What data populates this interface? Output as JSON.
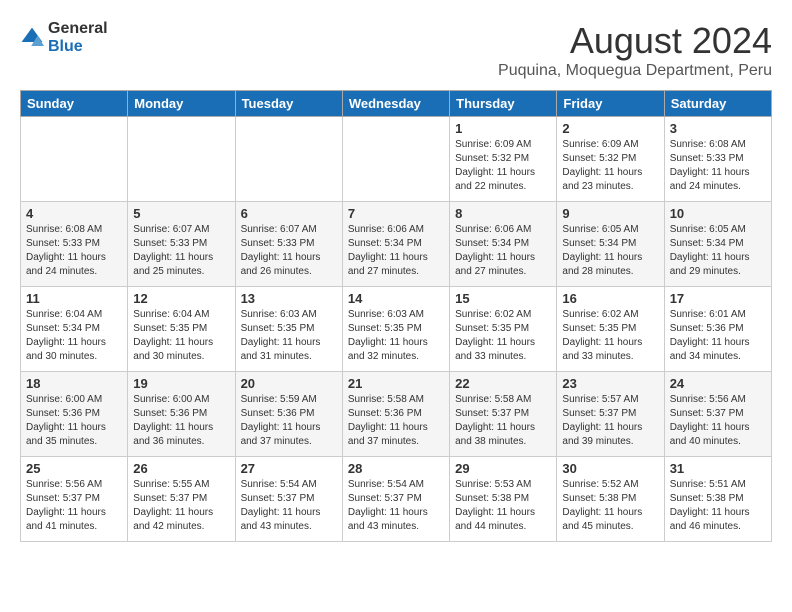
{
  "header": {
    "logo_general": "General",
    "logo_blue": "Blue",
    "month": "August 2024",
    "location": "Puquina, Moquegua Department, Peru"
  },
  "weekdays": [
    "Sunday",
    "Monday",
    "Tuesday",
    "Wednesday",
    "Thursday",
    "Friday",
    "Saturday"
  ],
  "weeks": [
    [
      {
        "day": "",
        "info": ""
      },
      {
        "day": "",
        "info": ""
      },
      {
        "day": "",
        "info": ""
      },
      {
        "day": "",
        "info": ""
      },
      {
        "day": "1",
        "info": "Sunrise: 6:09 AM\nSunset: 5:32 PM\nDaylight: 11 hours\nand 22 minutes."
      },
      {
        "day": "2",
        "info": "Sunrise: 6:09 AM\nSunset: 5:32 PM\nDaylight: 11 hours\nand 23 minutes."
      },
      {
        "day": "3",
        "info": "Sunrise: 6:08 AM\nSunset: 5:33 PM\nDaylight: 11 hours\nand 24 minutes."
      }
    ],
    [
      {
        "day": "4",
        "info": "Sunrise: 6:08 AM\nSunset: 5:33 PM\nDaylight: 11 hours\nand 24 minutes."
      },
      {
        "day": "5",
        "info": "Sunrise: 6:07 AM\nSunset: 5:33 PM\nDaylight: 11 hours\nand 25 minutes."
      },
      {
        "day": "6",
        "info": "Sunrise: 6:07 AM\nSunset: 5:33 PM\nDaylight: 11 hours\nand 26 minutes."
      },
      {
        "day": "7",
        "info": "Sunrise: 6:06 AM\nSunset: 5:34 PM\nDaylight: 11 hours\nand 27 minutes."
      },
      {
        "day": "8",
        "info": "Sunrise: 6:06 AM\nSunset: 5:34 PM\nDaylight: 11 hours\nand 27 minutes."
      },
      {
        "day": "9",
        "info": "Sunrise: 6:05 AM\nSunset: 5:34 PM\nDaylight: 11 hours\nand 28 minutes."
      },
      {
        "day": "10",
        "info": "Sunrise: 6:05 AM\nSunset: 5:34 PM\nDaylight: 11 hours\nand 29 minutes."
      }
    ],
    [
      {
        "day": "11",
        "info": "Sunrise: 6:04 AM\nSunset: 5:34 PM\nDaylight: 11 hours\nand 30 minutes."
      },
      {
        "day": "12",
        "info": "Sunrise: 6:04 AM\nSunset: 5:35 PM\nDaylight: 11 hours\nand 30 minutes."
      },
      {
        "day": "13",
        "info": "Sunrise: 6:03 AM\nSunset: 5:35 PM\nDaylight: 11 hours\nand 31 minutes."
      },
      {
        "day": "14",
        "info": "Sunrise: 6:03 AM\nSunset: 5:35 PM\nDaylight: 11 hours\nand 32 minutes."
      },
      {
        "day": "15",
        "info": "Sunrise: 6:02 AM\nSunset: 5:35 PM\nDaylight: 11 hours\nand 33 minutes."
      },
      {
        "day": "16",
        "info": "Sunrise: 6:02 AM\nSunset: 5:35 PM\nDaylight: 11 hours\nand 33 minutes."
      },
      {
        "day": "17",
        "info": "Sunrise: 6:01 AM\nSunset: 5:36 PM\nDaylight: 11 hours\nand 34 minutes."
      }
    ],
    [
      {
        "day": "18",
        "info": "Sunrise: 6:00 AM\nSunset: 5:36 PM\nDaylight: 11 hours\nand 35 minutes."
      },
      {
        "day": "19",
        "info": "Sunrise: 6:00 AM\nSunset: 5:36 PM\nDaylight: 11 hours\nand 36 minutes."
      },
      {
        "day": "20",
        "info": "Sunrise: 5:59 AM\nSunset: 5:36 PM\nDaylight: 11 hours\nand 37 minutes."
      },
      {
        "day": "21",
        "info": "Sunrise: 5:58 AM\nSunset: 5:36 PM\nDaylight: 11 hours\nand 37 minutes."
      },
      {
        "day": "22",
        "info": "Sunrise: 5:58 AM\nSunset: 5:37 PM\nDaylight: 11 hours\nand 38 minutes."
      },
      {
        "day": "23",
        "info": "Sunrise: 5:57 AM\nSunset: 5:37 PM\nDaylight: 11 hours\nand 39 minutes."
      },
      {
        "day": "24",
        "info": "Sunrise: 5:56 AM\nSunset: 5:37 PM\nDaylight: 11 hours\nand 40 minutes."
      }
    ],
    [
      {
        "day": "25",
        "info": "Sunrise: 5:56 AM\nSunset: 5:37 PM\nDaylight: 11 hours\nand 41 minutes."
      },
      {
        "day": "26",
        "info": "Sunrise: 5:55 AM\nSunset: 5:37 PM\nDaylight: 11 hours\nand 42 minutes."
      },
      {
        "day": "27",
        "info": "Sunrise: 5:54 AM\nSunset: 5:37 PM\nDaylight: 11 hours\nand 43 minutes."
      },
      {
        "day": "28",
        "info": "Sunrise: 5:54 AM\nSunset: 5:37 PM\nDaylight: 11 hours\nand 43 minutes."
      },
      {
        "day": "29",
        "info": "Sunrise: 5:53 AM\nSunset: 5:38 PM\nDaylight: 11 hours\nand 44 minutes."
      },
      {
        "day": "30",
        "info": "Sunrise: 5:52 AM\nSunset: 5:38 PM\nDaylight: 11 hours\nand 45 minutes."
      },
      {
        "day": "31",
        "info": "Sunrise: 5:51 AM\nSunset: 5:38 PM\nDaylight: 11 hours\nand 46 minutes."
      }
    ]
  ]
}
